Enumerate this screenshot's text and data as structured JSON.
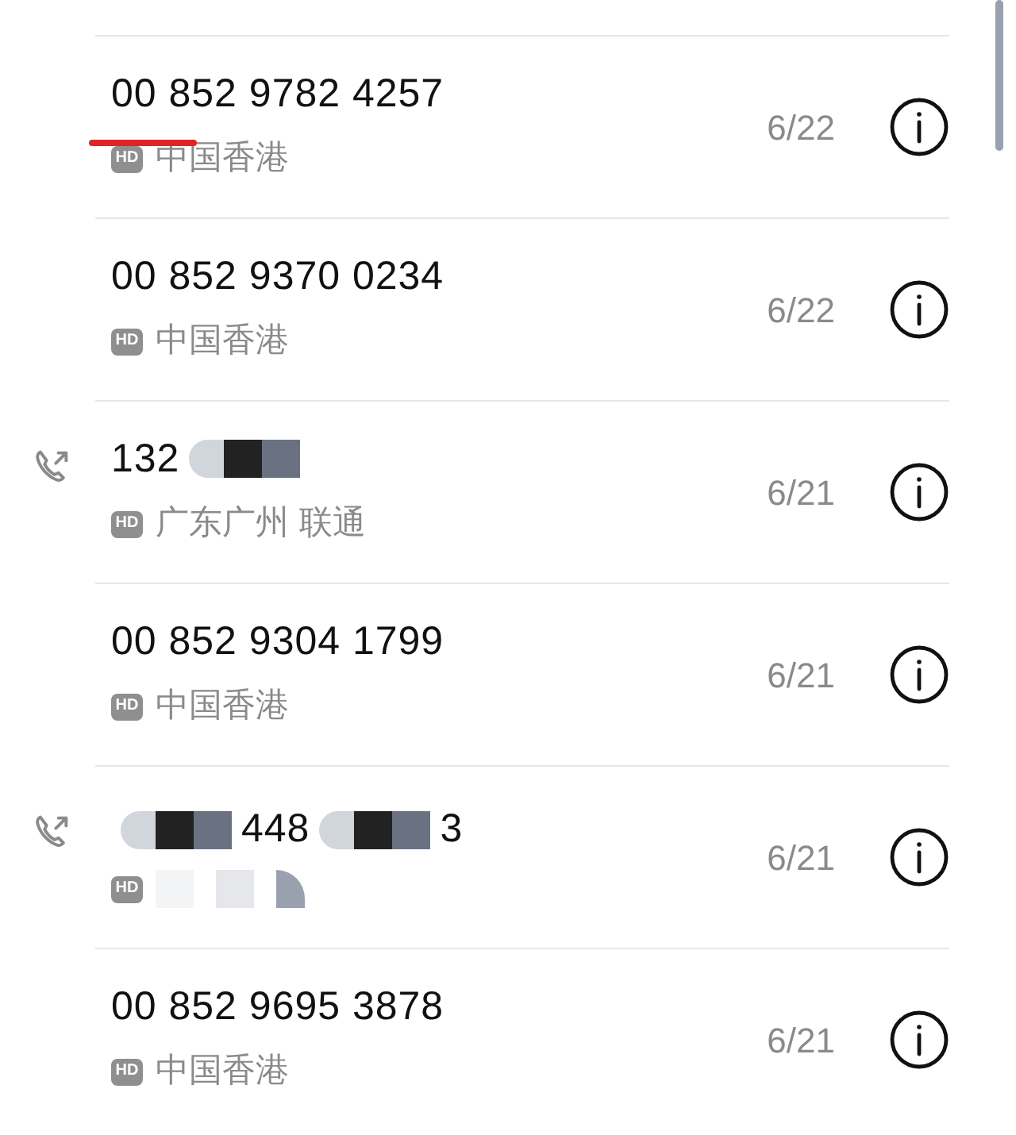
{
  "calls": [
    {
      "number_parts": [
        {
          "kind": "text",
          "text": "00 852 9782 4257"
        }
      ],
      "location": "中国香港",
      "badge": "HD",
      "date": "6/22",
      "outgoing": false,
      "underlined": true
    },
    {
      "number_parts": [
        {
          "kind": "text",
          "text": "00 852 9370 0234"
        }
      ],
      "location": "中国香港",
      "badge": "HD",
      "date": "6/22",
      "outgoing": false,
      "underlined": false
    },
    {
      "number_parts": [
        {
          "kind": "text",
          "text": "132"
        },
        {
          "kind": "redacted"
        }
      ],
      "location": "广东广州 联通",
      "badge": "HD",
      "date": "6/21",
      "outgoing": true,
      "underlined": false
    },
    {
      "number_parts": [
        {
          "kind": "text",
          "text": "00 852 9304 1799"
        }
      ],
      "location": "中国香港",
      "badge": "HD",
      "date": "6/21",
      "outgoing": false,
      "underlined": false
    },
    {
      "number_parts": [
        {
          "kind": "redacted"
        },
        {
          "kind": "text",
          "text": "448"
        },
        {
          "kind": "redacted"
        },
        {
          "kind": "text",
          "text": "3"
        }
      ],
      "location_redacted": true,
      "badge": "HD",
      "date": "6/21",
      "outgoing": true,
      "underlined": false
    },
    {
      "number_parts": [
        {
          "kind": "text",
          "text": "00 852 9695 3878"
        }
      ],
      "location": "中国香港",
      "badge": "HD",
      "date": "6/21",
      "outgoing": false,
      "underlined": false
    }
  ]
}
